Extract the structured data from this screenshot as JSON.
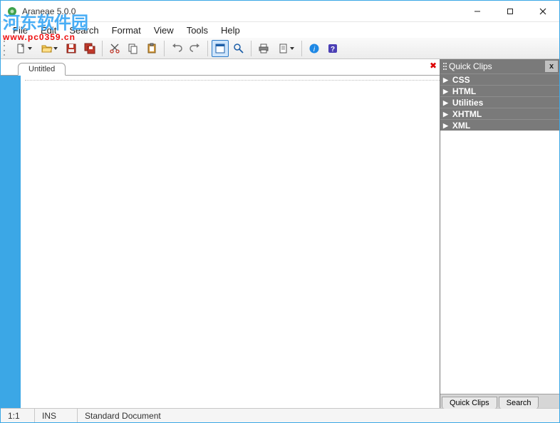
{
  "window": {
    "title": "Araneae 5.0.0",
    "controls": {
      "min": "—",
      "max": "▢",
      "close": "✕"
    }
  },
  "watermark": {
    "main": "河东软件园",
    "sub": "www.pc0359.cn"
  },
  "menu": {
    "file": "File",
    "edit": "Edit",
    "search": "Search",
    "format": "Format",
    "view": "View",
    "tools": "Tools",
    "help": "Help"
  },
  "toolbar": {
    "new": "New",
    "open": "Open",
    "save": "Save",
    "saveall": "Save All",
    "cut": "Cut",
    "copy": "Copy",
    "paste": "Paste",
    "undo": "Undo",
    "redo": "Redo",
    "preview": "Toggle Preview",
    "find": "Find",
    "print": "Print",
    "printpreview": "Print Preview",
    "about": "About",
    "help": "Help"
  },
  "tabs": {
    "items": [
      {
        "label": "Untitled"
      }
    ],
    "close_x": "✖"
  },
  "sidepanel": {
    "title": "Quick Clips",
    "close": "x",
    "items": [
      {
        "label": "CSS"
      },
      {
        "label": "HTML"
      },
      {
        "label": "Utilities"
      },
      {
        "label": "XHTML"
      },
      {
        "label": "XML"
      }
    ],
    "bottom_tabs": {
      "quickclips": "Quick Clips",
      "search": "Search"
    }
  },
  "statusbar": {
    "pos": "1:1",
    "ins": "INS",
    "doctype": "Standard Document"
  },
  "colors": {
    "accent": "#3ba7e6",
    "panel_header": "#7a7a7a"
  }
}
